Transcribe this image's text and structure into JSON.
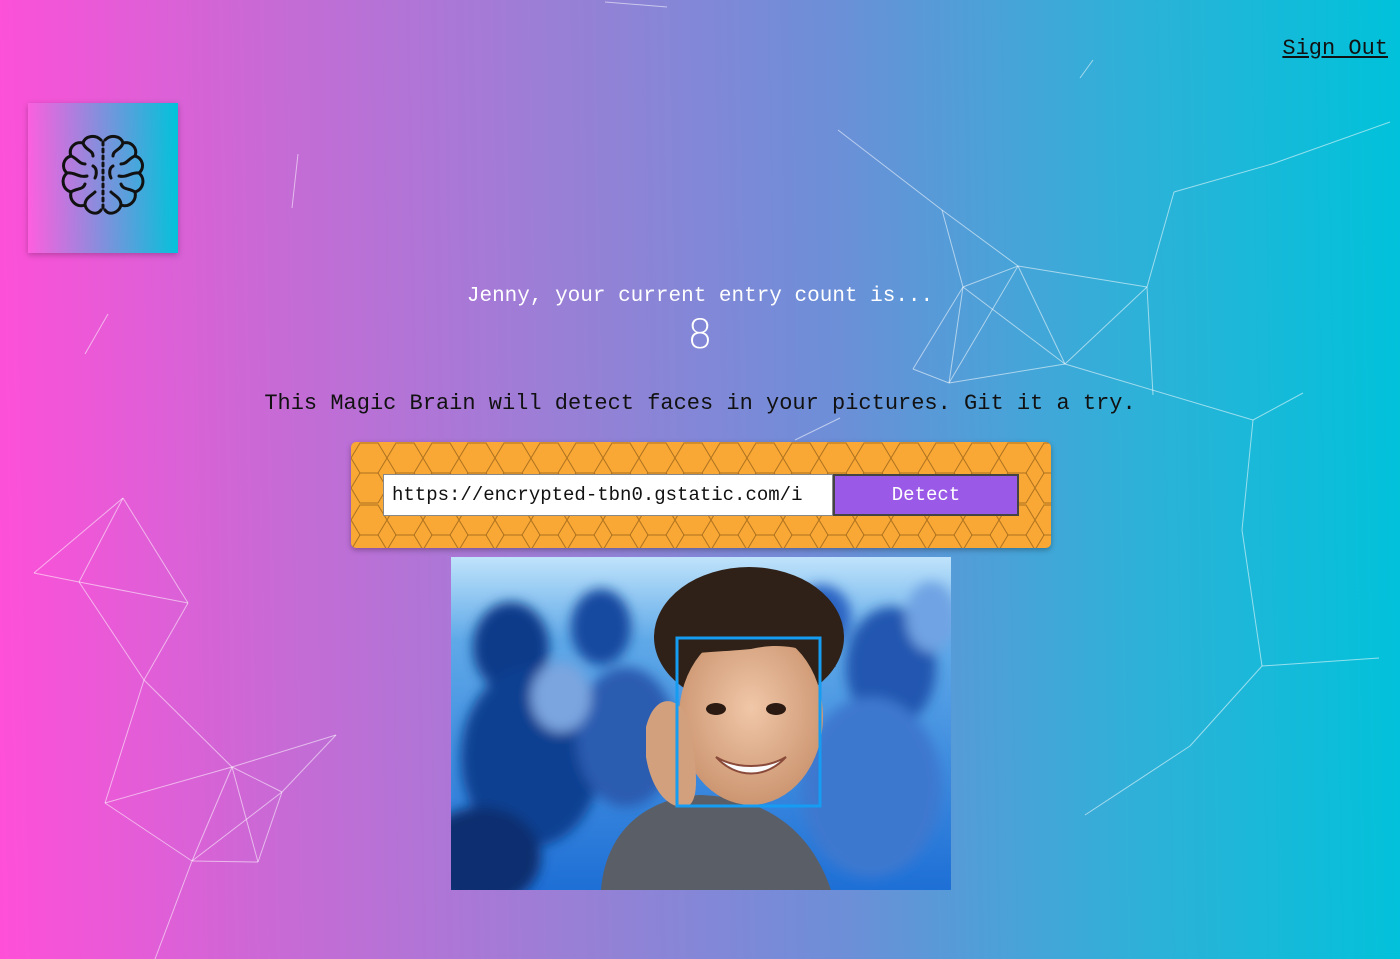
{
  "navigation": {
    "sign_out_label": "Sign Out"
  },
  "logo": {
    "icon": "brain-icon"
  },
  "rank": {
    "intro_text": "Jenny, your current entry count is...",
    "count": "8"
  },
  "description": "This Magic Brain will detect faces in your pictures. Git it a try.",
  "image_form": {
    "url_value": "https://encrypted-tbn0.gstatic.com/i",
    "detect_label": "Detect"
  },
  "face_recognition": {
    "image_subject": "smiling boy resting chin on hand",
    "face_box_color": "#149df2"
  },
  "colors": {
    "gradient_start": "#ff4fd8",
    "gradient_end": "#00c2da",
    "form_panel": "#f9a735",
    "detect_button": "#9b59e8"
  }
}
